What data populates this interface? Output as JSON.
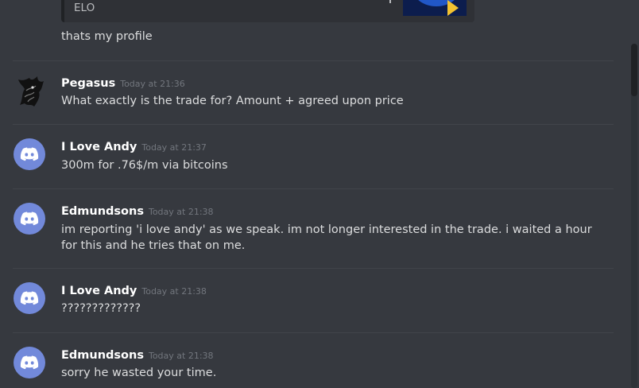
{
  "embed": {
    "text": "ELO"
  },
  "prev_message": {
    "text": "thats my profile"
  },
  "messages": [
    {
      "username": "Pegasus",
      "timestamp": "Today at 21:36",
      "text": "What exactly is the trade for? Amount + agreed upon price",
      "avatar": "pegasus-avatar"
    },
    {
      "username": "I Love Andy",
      "timestamp": "Today at 21:37",
      "text": "300m for .76$/m via bitcoins",
      "avatar": "discord-default-avatar"
    },
    {
      "username": "Edmundsons",
      "timestamp": "Today at 21:38",
      "text": "im reporting 'i love andy' as we speak. im not longer interested in the trade.  i waited a hour for this and he tries that on me.",
      "avatar": "discord-default-avatar"
    },
    {
      "username": "I Love Andy",
      "timestamp": "Today at 21:38",
      "text": "?????????????",
      "avatar": "discord-default-avatar"
    },
    {
      "username": "Edmundsons",
      "timestamp": "Today at 21:38",
      "text": "sorry he wasted your time.",
      "avatar": "discord-default-avatar"
    }
  ],
  "colors": {
    "background": "#36393f",
    "avatar_blurple": "#7289da",
    "username": "#ffffff",
    "timestamp": "#72767d",
    "text": "#dcddde"
  }
}
